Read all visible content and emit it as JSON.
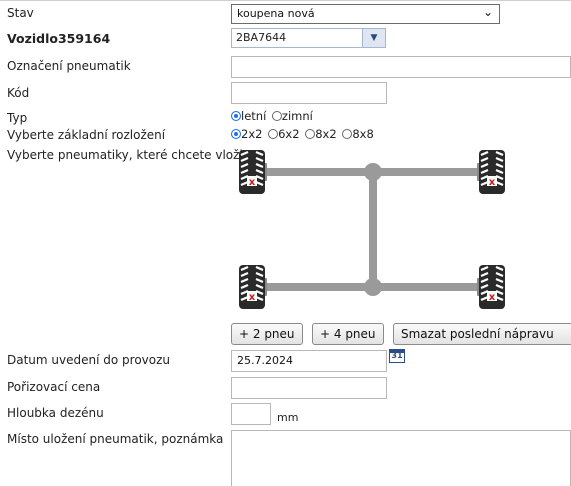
{
  "form": {
    "stav_label": "Stav",
    "stav_value": "koupena nová",
    "vozidlo_label": "Vozidlo359164",
    "vozidlo_value": "2BA7644",
    "oznaceni_label": "Označení pneumatik",
    "oznaceni_value": "",
    "kod_label": "Kód",
    "kod_value": "",
    "typ_label": "Typ",
    "typ_options": [
      "letní",
      "zimní"
    ],
    "typ_selected": "letní",
    "rozlozeni_label": "Vyberte základní rozložení",
    "rozlozeni_options": [
      "2x2",
      "6x2",
      "8x2",
      "8x8"
    ],
    "rozlozeni_selected": "2x2",
    "pneumatiky_label": "Vyberte pneumatiky, které chcete vložit:",
    "buttons": {
      "add2": "+ 2 pneu",
      "add4": "+ 4 pneu",
      "remove_axle": "Smazat poslední nápravu"
    },
    "datum_label": "Datum uvedení do provozu",
    "datum_value": "25.7.2024",
    "calendar_text": "31",
    "cena_label": "Pořizovací cena",
    "cena_value": "",
    "hloubka_label": "Hloubka dezénu",
    "hloubka_value": "",
    "hloubka_unit": "mm",
    "misto_label": "Místo uložení pneumatik, poznámka",
    "misto_value": ""
  },
  "colors": {
    "axle": "#9a9a9a",
    "tire": "#2a2a2a",
    "tire_mark": "#d01818",
    "radio_on": "#1a73e8"
  }
}
